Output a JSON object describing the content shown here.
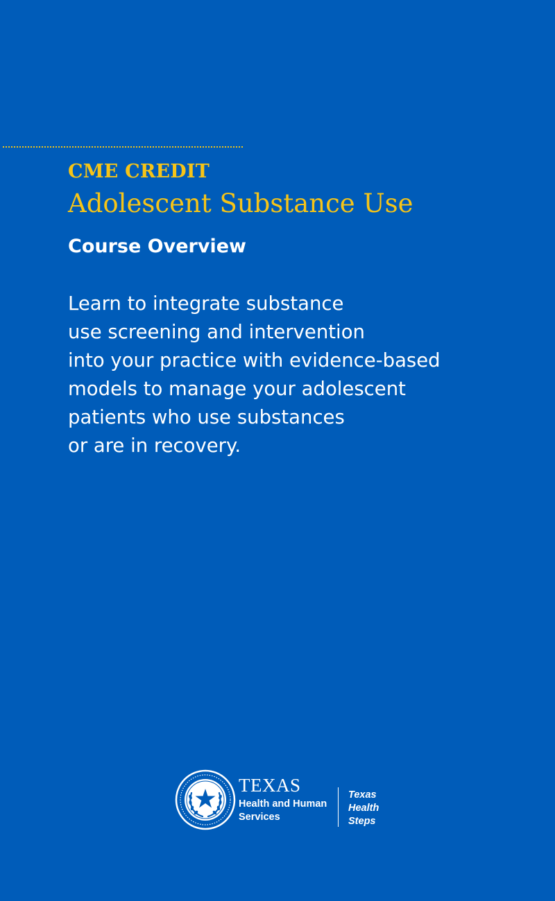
{
  "header": {
    "eyebrow": "CME CREDIT",
    "title": "Adolescent Substance Use",
    "subtitle": "Course Overview"
  },
  "description": {
    "lines": [
      "Learn to integrate substance",
      "use screening and intervention",
      "into your practice with evidence-based",
      "models to manage your adolescent",
      "patients who use substances",
      "or are in recovery."
    ]
  },
  "footer": {
    "seal_icon": "texas-state-seal-icon",
    "agency": {
      "state": "TEXAS",
      "line1": "Health and Human",
      "line2": "Services"
    },
    "program": {
      "line1": "Texas",
      "line2": "Health",
      "line3": "Steps"
    }
  },
  "colors": {
    "background": "#005cb9",
    "accent": "#f6c417",
    "text": "#ffffff"
  }
}
